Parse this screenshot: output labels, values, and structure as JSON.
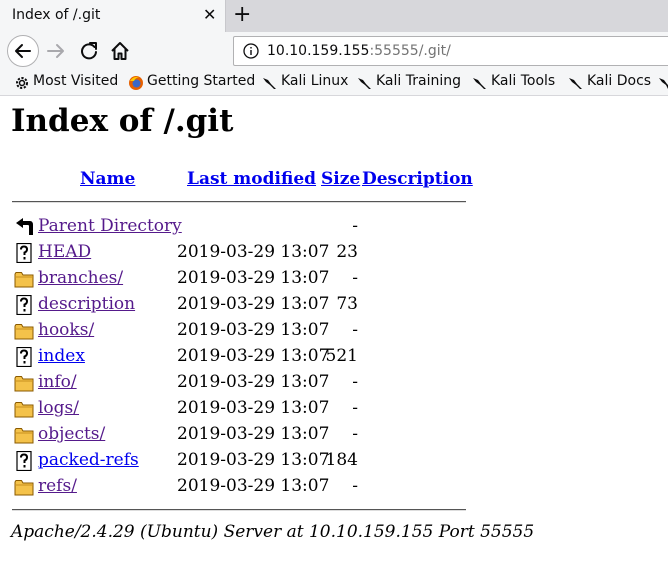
{
  "browser": {
    "tab_title": "Index of /.git",
    "url_host": "10.10.159.155",
    "url_rest": ":55555/.git/",
    "bookmarks": [
      {
        "label": "Most Visited",
        "icon": "gear-icon"
      },
      {
        "label": "Getting Started",
        "icon": "firefox-icon"
      },
      {
        "label": "Kali Linux",
        "icon": "kali-dragon-icon"
      },
      {
        "label": "Kali Training",
        "icon": "kali-dragon-icon"
      },
      {
        "label": "Kali Tools",
        "icon": "kali-dragon-icon"
      },
      {
        "label": "Kali Docs",
        "icon": "kali-dragon-icon"
      }
    ]
  },
  "page": {
    "heading": "Index of /.git",
    "columns": {
      "name": "Name",
      "last_modified": "Last modified",
      "size": "Size",
      "description": "Description"
    },
    "rows": [
      {
        "icon": "back-folder-icon",
        "name": "Parent Directory",
        "date": "",
        "size": "-",
        "visited": true
      },
      {
        "icon": "file-unknown-icon",
        "name": "HEAD",
        "date": "2019-03-29 13:07",
        "size": "23",
        "visited": true
      },
      {
        "icon": "folder-icon",
        "name": "branches/",
        "date": "2019-03-29 13:07",
        "size": "-",
        "visited": true
      },
      {
        "icon": "file-unknown-icon",
        "name": "description",
        "date": "2019-03-29 13:07",
        "size": "73",
        "visited": true
      },
      {
        "icon": "folder-icon",
        "name": "hooks/",
        "date": "2019-03-29 13:07",
        "size": "-",
        "visited": true
      },
      {
        "icon": "file-unknown-icon",
        "name": "index",
        "date": "2019-03-29 13:07",
        "size": "521",
        "visited": false
      },
      {
        "icon": "folder-icon",
        "name": "info/",
        "date": "2019-03-29 13:07",
        "size": "-",
        "visited": true
      },
      {
        "icon": "folder-icon",
        "name": "logs/",
        "date": "2019-03-29 13:07",
        "size": "-",
        "visited": true
      },
      {
        "icon": "folder-icon",
        "name": "objects/",
        "date": "2019-03-29 13:07",
        "size": "-",
        "visited": true
      },
      {
        "icon": "file-unknown-icon",
        "name": "packed-refs",
        "date": "2019-03-29 13:07",
        "size": "184",
        "visited": false
      },
      {
        "icon": "folder-icon",
        "name": "refs/",
        "date": "2019-03-29 13:07",
        "size": "-",
        "visited": true
      }
    ],
    "footer": "Apache/2.4.29 (Ubuntu) Server at 10.10.159.155 Port 55555"
  }
}
